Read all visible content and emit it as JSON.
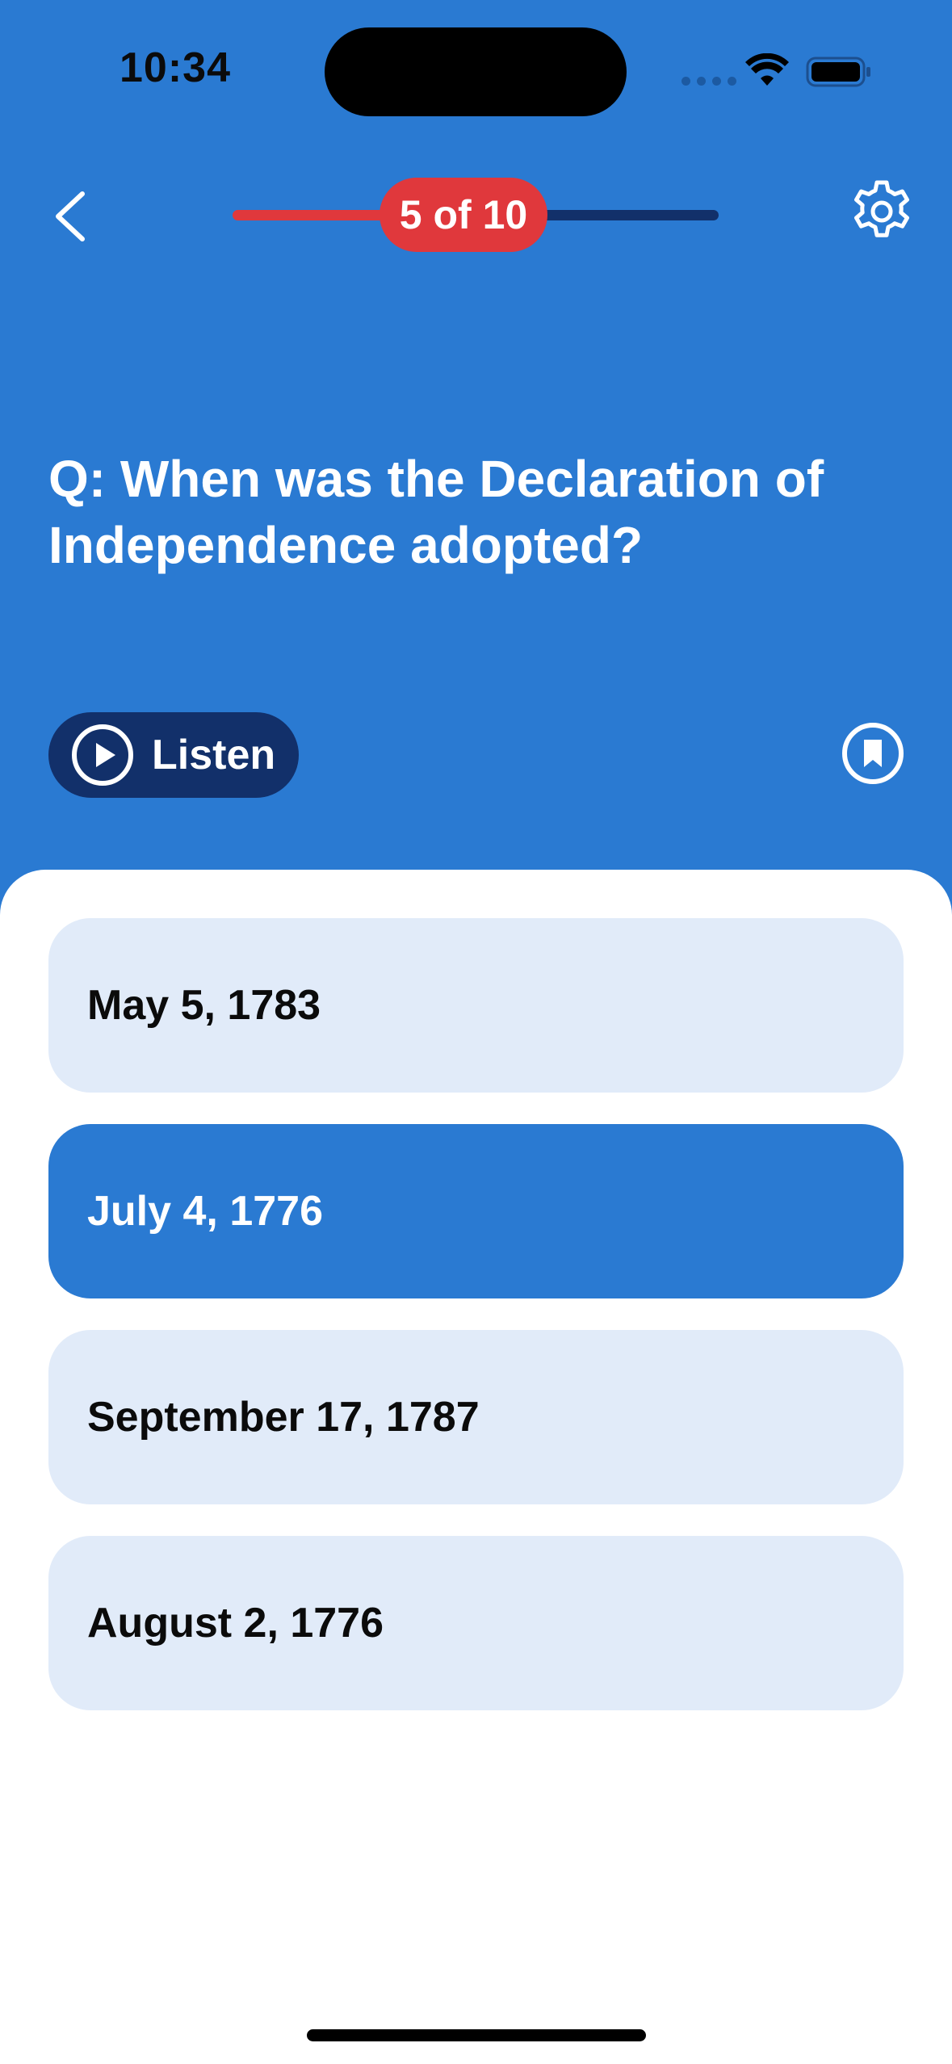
{
  "status_bar": {
    "time": "10:34"
  },
  "header": {
    "progress_label": "5 of 10",
    "progress": {
      "current": 5,
      "total": 10
    },
    "icons": {
      "back": "chevron-left-icon",
      "settings": "gear-icon"
    }
  },
  "question": {
    "text": "Q: When was the Declaration of Independence adopted?"
  },
  "listen": {
    "label": "Listen",
    "icon": "play-circle-icon",
    "bookmark_icon": "bookmark-icon"
  },
  "options": [
    {
      "label": "May 5, 1783",
      "selected": false
    },
    {
      "label": "July 4, 1776",
      "selected": true
    },
    {
      "label": "September 17, 1787",
      "selected": false
    },
    {
      "label": "August 2, 1776",
      "selected": false
    }
  ],
  "colors": {
    "background": "#2A7AD2",
    "accent_red": "#E0383C",
    "dark_navy": "#12306A",
    "option_bg": "#E1EBF9",
    "option_selected_bg": "#2A7AD2"
  }
}
